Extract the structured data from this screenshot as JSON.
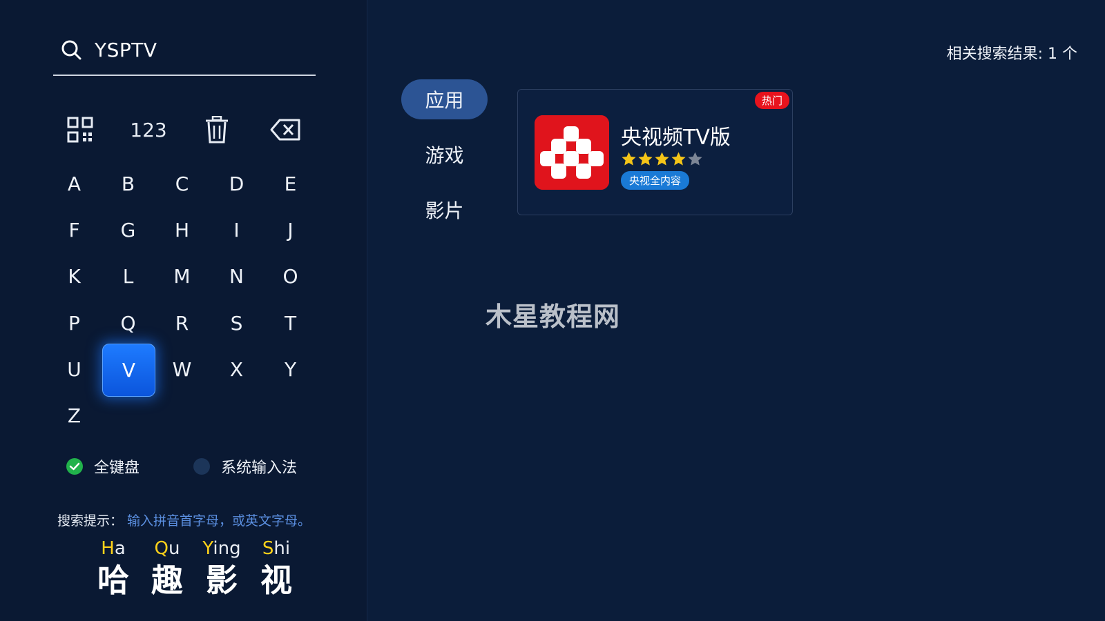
{
  "search": {
    "query": "YSPTV"
  },
  "function_keys": {
    "numeric_label": "123"
  },
  "keyboard": {
    "keys": [
      "A",
      "B",
      "C",
      "D",
      "E",
      "F",
      "G",
      "H",
      "I",
      "J",
      "K",
      "L",
      "M",
      "N",
      "O",
      "P",
      "Q",
      "R",
      "S",
      "T",
      "U",
      "V",
      "W",
      "X",
      "Y",
      "Z"
    ],
    "focused_key": "V"
  },
  "input_mode": {
    "options": [
      {
        "label": "全键盘",
        "selected": true
      },
      {
        "label": "系统输入法",
        "selected": false
      }
    ]
  },
  "hint": {
    "label": "搜索提示：",
    "text": "输入拼音首字母，或英文字母。"
  },
  "brand": {
    "columns": [
      {
        "initial": "H",
        "rest": "a",
        "hanzi": "哈"
      },
      {
        "initial": "Q",
        "rest": "u",
        "hanzi": "趣"
      },
      {
        "initial": "Y",
        "rest": "ing",
        "hanzi": "影"
      },
      {
        "initial": "S",
        "rest": "hi",
        "hanzi": "视"
      }
    ]
  },
  "results": {
    "count_text": "相关搜索结果: 1 个"
  },
  "tabs": [
    {
      "label": "应用",
      "active": true
    },
    {
      "label": "游戏",
      "active": false
    },
    {
      "label": "影片",
      "active": false
    }
  ],
  "app": {
    "name": "央视频TV版",
    "badge": "热门",
    "rating": 4,
    "rating_max": 5,
    "tag": "央视全内容",
    "icon_color": "#e0141c"
  },
  "watermark": "木星教程网",
  "colors": {
    "accent_blue": "#1e7bff",
    "hint_blue": "#5b8fe0",
    "pinyin_yellow": "#ffd21a",
    "hot_red": "#e8131d",
    "star_gold": "#f5c518",
    "check_green": "#21b24b"
  }
}
